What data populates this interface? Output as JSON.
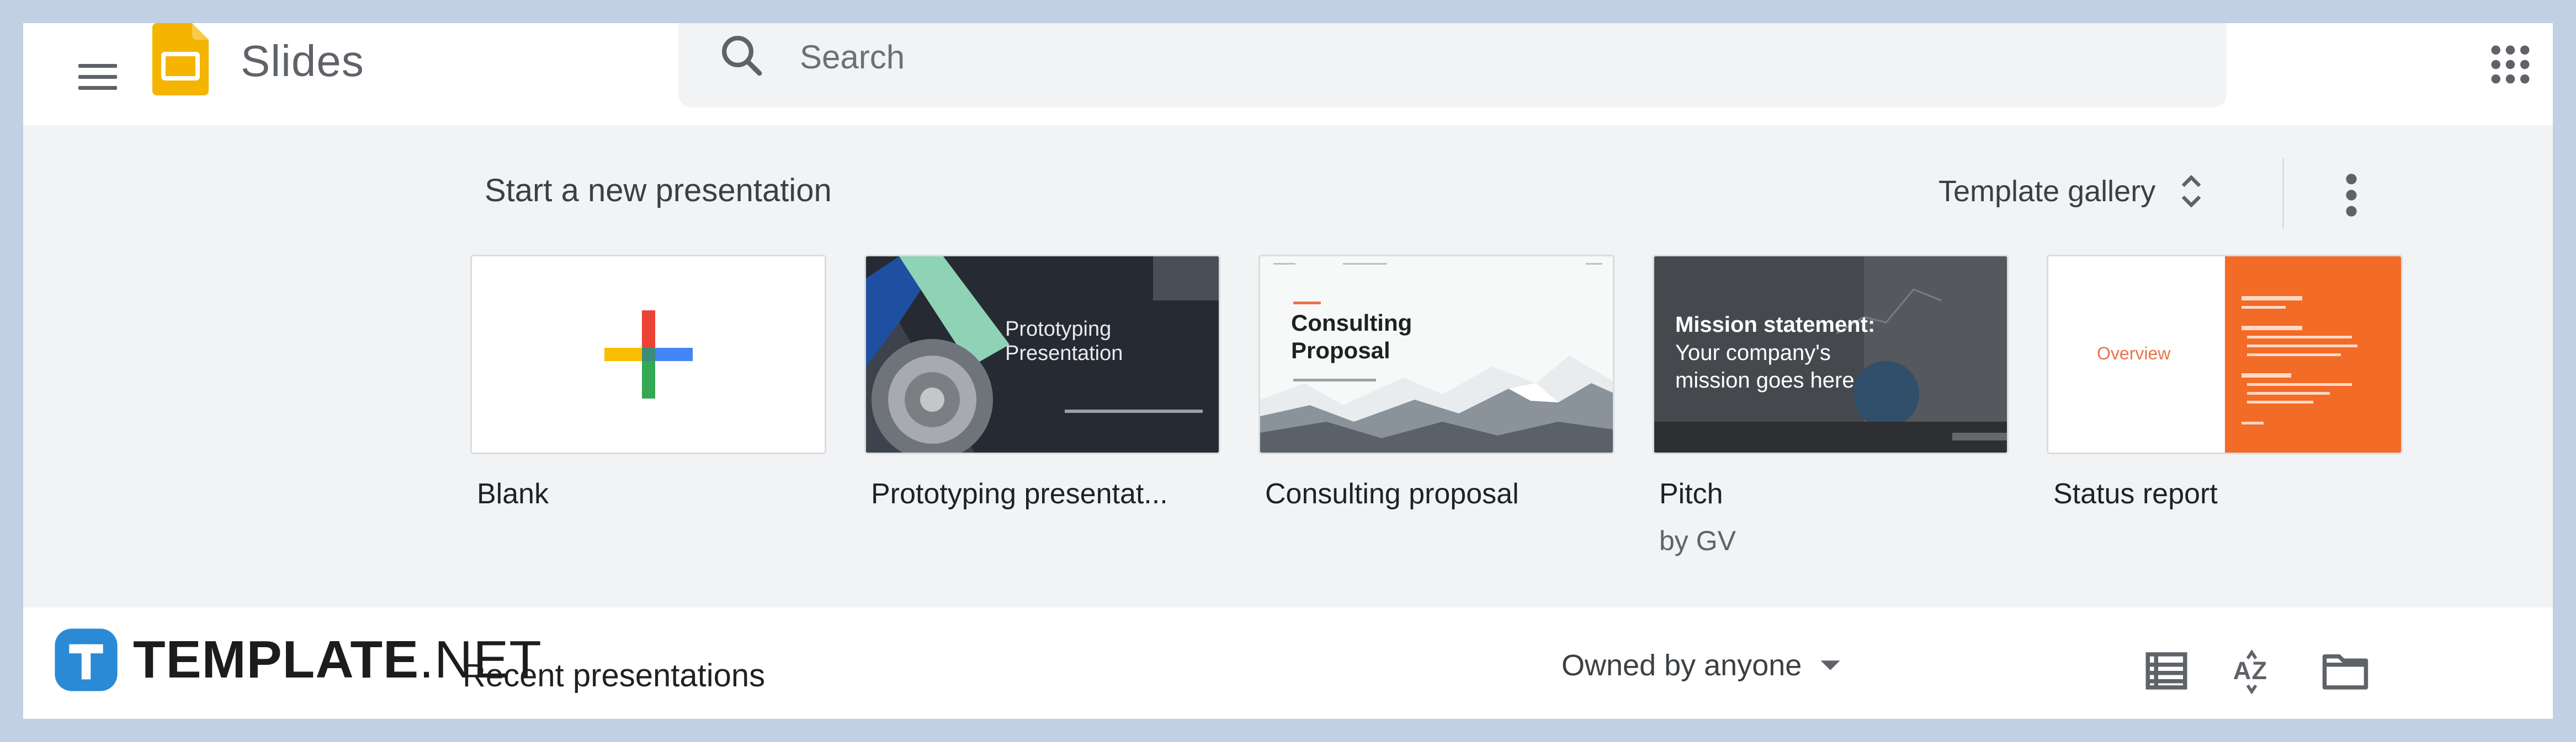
{
  "app": {
    "title": "Slides",
    "icons": {
      "menu": "hamburger-menu-icon",
      "logo": "slides-logo-icon",
      "apps": "apps-grid-icon"
    },
    "colors": {
      "logo_yellow": "#f4b400",
      "accent_orange": "#f26b27"
    }
  },
  "search": {
    "placeholder": "Search",
    "value": ""
  },
  "templates": {
    "section_title": "Start a new presentation",
    "gallery_label": "Template gallery",
    "items": [
      {
        "label": "Blank",
        "subtitle": ""
      },
      {
        "label": "Prototyping presentat...",
        "subtitle": "",
        "thumb_title": "Prototyping\nPresentation"
      },
      {
        "label": "Consulting proposal",
        "subtitle": "",
        "thumb_title": "Consulting\nProposal"
      },
      {
        "label": "Pitch",
        "subtitle": "by GV",
        "thumb_title": "Mission statement:",
        "thumb_body": "Your company's\nmission goes here"
      },
      {
        "label": "Status report",
        "subtitle": "",
        "thumb_title": "Overview"
      }
    ]
  },
  "recent": {
    "title": "Recent presentations",
    "owner_filter": "Owned by anyone",
    "icons": [
      "list-view-icon",
      "sort-az-icon",
      "folder-icon"
    ]
  },
  "watermark": {
    "brand": "TEMPLATE",
    "suffix": ".NET",
    "logo_letter": "T"
  }
}
